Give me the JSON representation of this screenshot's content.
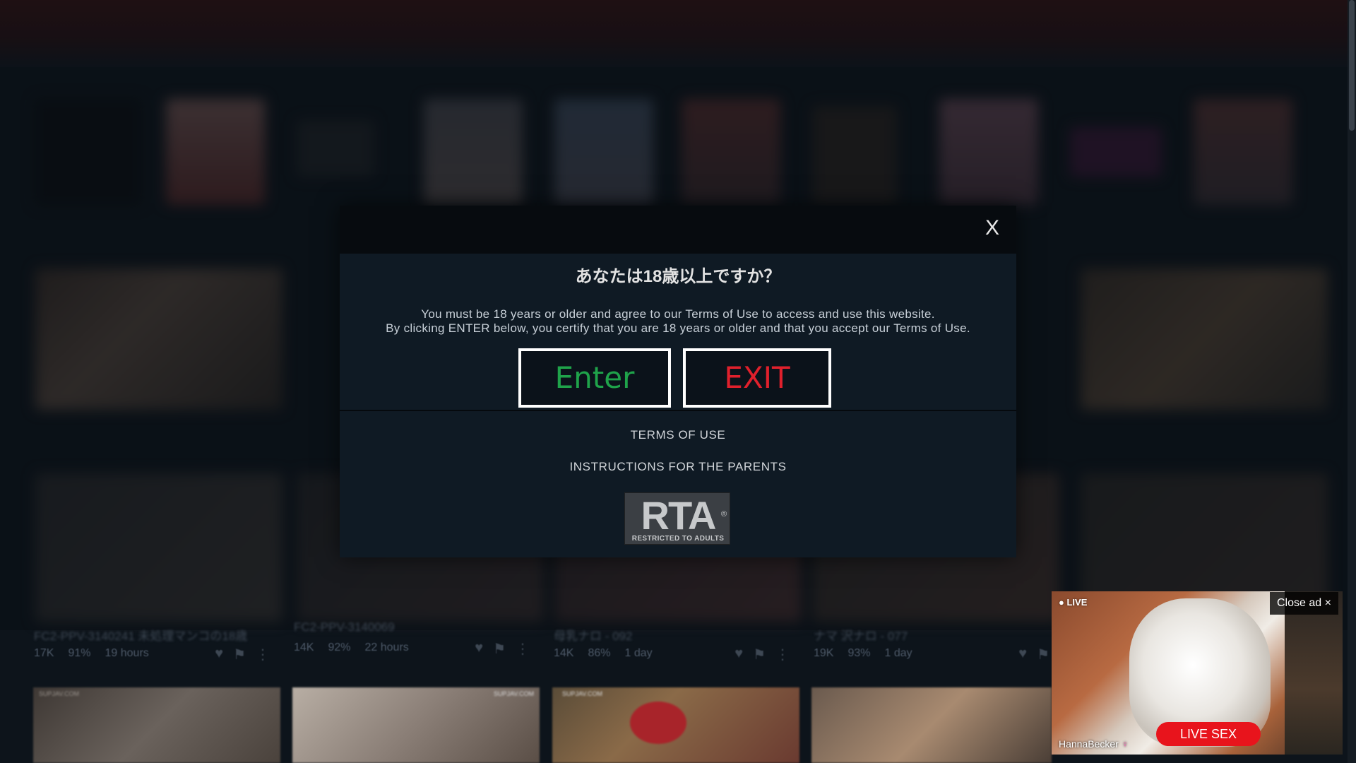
{
  "modal": {
    "close_label": "X",
    "title": "あなたは18歳以上ですか？",
    "text_line1": "You must be 18 years or older and agree to our Terms of Use to access and use this website.",
    "text_line2": "By clicking ENTER below, you certify that you are 18 years or older and that you accept our Terms of Use.",
    "enter_label": "Enter",
    "exit_label": "EXIT",
    "terms_link": "TERMS OF USE",
    "parents_link": "INSTRUCTIONS FOR THE PARENTS",
    "badge": {
      "big": "RTA",
      "reg": "®",
      "small": "RESTRICTED TO ADULTS"
    }
  },
  "videos": [
    {
      "title": "FC2-PPV-3140241 未処理マンコの18歳",
      "views": "17K",
      "rating": "91%",
      "age": "19 hours"
    },
    {
      "title": "FC2-PPV-3140069",
      "views": "14K",
      "rating": "92%",
      "age": "22 hours"
    },
    {
      "title": "母乳ナロ - 092",
      "views": "14K",
      "rating": "86%",
      "age": "1 day"
    },
    {
      "title": "ナマ 沢ナロ - 077",
      "views": "19K",
      "rating": "93%",
      "age": "1 day"
    }
  ],
  "watermarks": [
    "SUPJAV.COM",
    "SUPJAV.COM",
    "SUPJAV.COM"
  ],
  "ad": {
    "live_label": "● LIVE",
    "close_label": "Close ad ×",
    "cta_label": "LIVE SEX",
    "username": "HannaBecker",
    "user_icon": "♀"
  },
  "colors": {
    "enter": "#1fa34a",
    "exit": "#e0202c",
    "modal_bg": "#0f1a24",
    "ad_cta": "#e8141c"
  }
}
